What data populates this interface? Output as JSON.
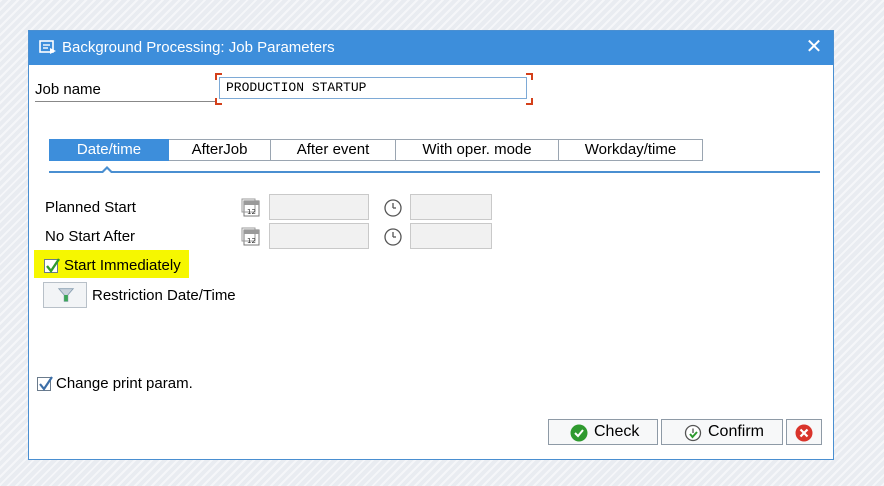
{
  "dialog": {
    "title": "Background Processing: Job Parameters",
    "close_symbol": "✕"
  },
  "job": {
    "label": "Job name",
    "value": "PRODUCTION STARTUP"
  },
  "tabs": [
    {
      "label": "Date/time",
      "active": true
    },
    {
      "label": "AfterJob",
      "active": false
    },
    {
      "label": "After event",
      "active": false
    },
    {
      "label": "With oper. mode",
      "active": false
    },
    {
      "label": "Workday/time",
      "active": false
    }
  ],
  "schedule": {
    "planned_start_label": "Planned Start",
    "no_start_after_label": "No Start After",
    "start_immediately_label": "Start Immediately",
    "start_immediately_checked": true,
    "restriction_label": "Restriction Date/Time"
  },
  "print": {
    "label": "Change print param.",
    "checked": true
  },
  "buttons": {
    "check_label": "Check",
    "confirm_label": "Confirm"
  },
  "icons": {
    "title": "job-dialog-icon",
    "calendar": "calendar-icon",
    "clock": "clock-icon",
    "check": "check-icon",
    "confirm": "confirm-icon",
    "cancel": "cancel-icon"
  },
  "colors": {
    "accent": "#3d8edb",
    "highlight": "#f6f700",
    "check_green": "#2f9a2f",
    "cancel_red": "#d9342b"
  }
}
